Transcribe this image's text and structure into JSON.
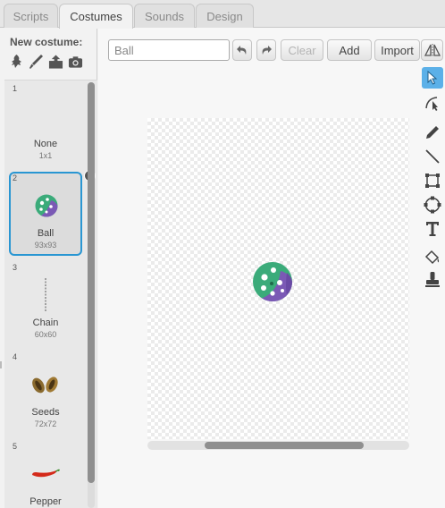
{
  "tabs": [
    {
      "label": "Scripts",
      "active": false
    },
    {
      "label": "Costumes",
      "active": true
    },
    {
      "label": "Sounds",
      "active": false
    },
    {
      "label": "Design",
      "active": false
    }
  ],
  "new_costume": {
    "label": "New costume:",
    "icons": [
      "paint-new-costume-icon",
      "brush-icon",
      "upload-icon",
      "camera-icon"
    ]
  },
  "costumes": [
    {
      "number": "1",
      "name": "None",
      "size": "1x1",
      "selected": false
    },
    {
      "number": "2",
      "name": "Ball",
      "size": "93x93",
      "selected": true
    },
    {
      "number": "3",
      "name": "Chain",
      "size": "60x60",
      "selected": false
    },
    {
      "number": "4",
      "name": "Seeds",
      "size": "72x72",
      "selected": false
    },
    {
      "number": "5",
      "name": "Pepper",
      "size": "",
      "selected": false
    }
  ],
  "editor": {
    "name_value": "Ball",
    "undo_icon": "undo-icon",
    "redo_icon": "redo-icon",
    "clear_label": "Clear",
    "add_label": "Add",
    "import_label": "Import",
    "flip_icon": "flip-horizontal-icon"
  },
  "tools": [
    {
      "name": "select-arrow-icon",
      "active": true
    },
    {
      "name": "reshape-icon",
      "active": false
    },
    {
      "name": "pencil-icon",
      "active": false
    },
    {
      "name": "line-icon",
      "active": false
    },
    {
      "name": "rectangle-icon",
      "active": false
    },
    {
      "name": "ellipse-icon",
      "active": false
    },
    {
      "name": "text-icon",
      "active": false
    },
    {
      "name": "paint-bucket-icon",
      "active": false
    },
    {
      "name": "stamp-icon",
      "active": false
    }
  ],
  "colors": {
    "accent": "#2996d2",
    "active_tool": "#5bb0e8",
    "ball_green": "#3bab7a",
    "ball_purple": "#7b59b5",
    "pepper_red": "#d42a1a"
  }
}
